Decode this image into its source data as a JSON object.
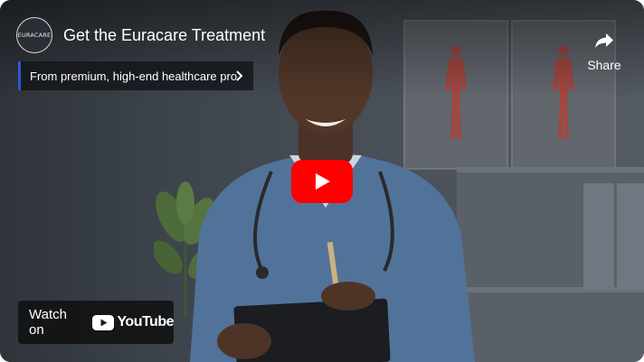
{
  "video": {
    "title": "Get the Euracare Treatment",
    "channel_logo_text": "EURACARE",
    "banner_text": "From premium, high-end  healthcare pro",
    "share_label": "Share",
    "watch_on_label": "Watch on",
    "youtube_wordmark": "YouTube"
  },
  "icons": {
    "share": "share-arrow-icon",
    "banner": "chevron-right-icon",
    "play": "play-icon",
    "youtube": "youtube-logo-icon"
  },
  "colors": {
    "play_button": "#ff0000",
    "banner_accent": "#2a58d6",
    "overlay": "#000000"
  }
}
